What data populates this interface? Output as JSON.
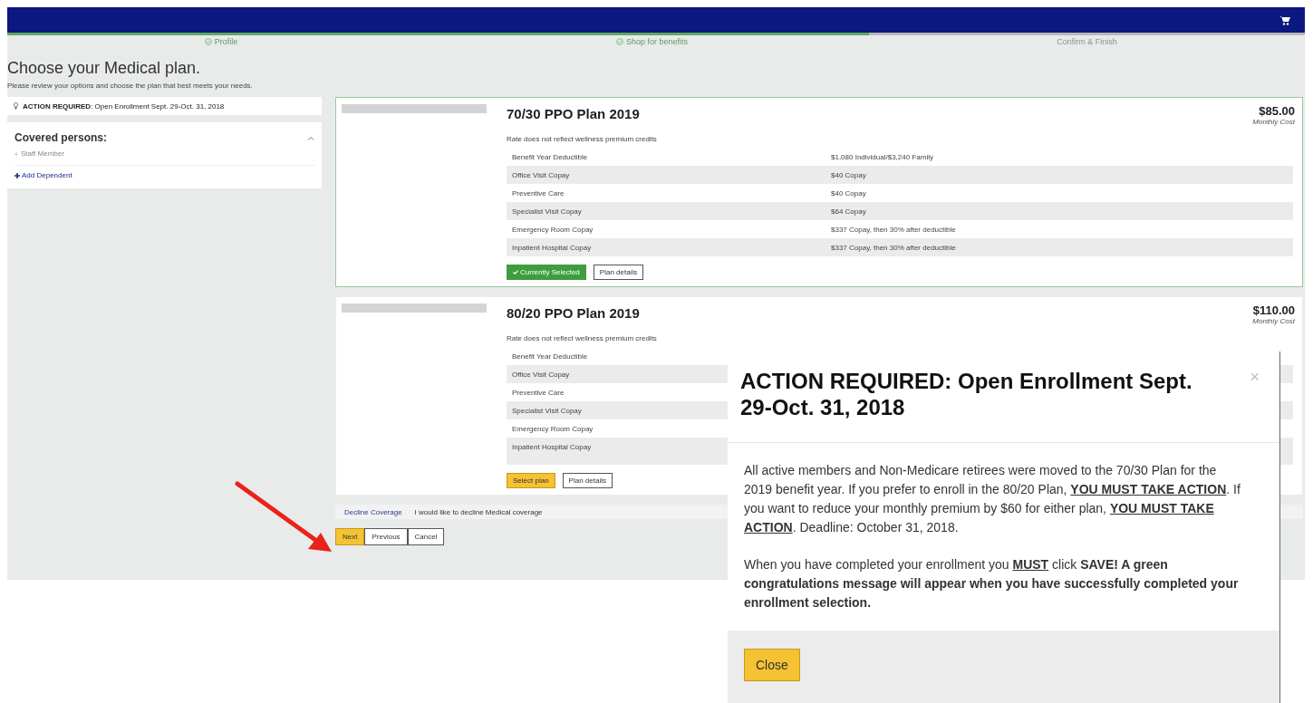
{
  "steps": [
    {
      "label": "Profile",
      "complete": true
    },
    {
      "label": "Shop for benefits",
      "complete": true
    },
    {
      "label": "Confirm & Finish",
      "complete": false
    }
  ],
  "heading": "Choose your Medical plan.",
  "subheading": "Please review your options and choose the plan that best meets your needs.",
  "sidebar": {
    "notice": "**ACTION REQUIRED**: Open Enrollment Sept. 29-Oct. 31, 2018",
    "covered_title": "Covered persons:",
    "expanded": true,
    "members": [
      "Staff Member"
    ],
    "add_link": "Add Dependent"
  },
  "plans": [
    {
      "name": "70/30 PPO Plan 2019",
      "price": "$85.00",
      "price_caption": "Monthly Cost",
      "note": "Rate does not reflect wellness premium credits",
      "selected": true,
      "action_label": "Currently Selected",
      "details_label": "Plan details",
      "rows": [
        {
          "label": "Benefit Year Deductible",
          "value": "$1,080 Individual/$3,240 Family"
        },
        {
          "label": "Office Visit Copay",
          "value": "$40 Copay"
        },
        {
          "label": "Preventive Care",
          "value": "$40 Copay"
        },
        {
          "label": "Specialist Visit Copay",
          "value": "$64 Copay"
        },
        {
          "label": "Emergency Room Copay",
          "value": "$337 Copay, then 30% after deductible"
        },
        {
          "label": "Inpatient Hospital Copay",
          "value": "$337 Copay, then 30% after deductible"
        }
      ]
    },
    {
      "name": "80/20 PPO Plan 2019",
      "price": "$110.00",
      "price_caption": "Monthly Cost",
      "note": "Rate does not reflect wellness premium credits",
      "selected": false,
      "action_label": "Select plan",
      "details_label": "Plan details",
      "rows": [
        {
          "label": "Benefit Year Deductible"
        },
        {
          "label": "Office Visit Copay"
        },
        {
          "label": "Preventive Care"
        },
        {
          "label": "Specialist Visit Copay"
        },
        {
          "label": "Emergency Room Copay"
        },
        {
          "label": "Inpatient Hospital Copay"
        }
      ]
    }
  ],
  "decline": {
    "link": "Decline Coverage",
    "text": "I would like to decline Medical coverage"
  },
  "nav_buttons": [
    {
      "label": "Next",
      "primary": true
    },
    {
      "label": "Previous",
      "primary": false
    },
    {
      "label": "Cancel",
      "primary": false
    }
  ],
  "modal": {
    "title": "ACTION REQUIRED: Open Enrollment Sept. 29-Oct. 31, 2018",
    "close_glyph": "×",
    "paragraphs": [
      [
        {
          "text": "All active members and Non-Medicare retirees were moved to the 70/30 Plan for the 2019 benefit year. If you prefer to enroll in the 80/20 Plan, "
        },
        {
          "text": "YOU MUST TAKE ACTION",
          "bold": true,
          "underline": true
        },
        {
          "text": ". If you want to reduce your monthly premium by $60 for either plan, "
        },
        {
          "text": "YOU MUST TAKE ACTION",
          "bold": true,
          "underline": true
        },
        {
          "text": ". Deadline: October 31, 2018."
        }
      ],
      [
        {
          "text": "When you have completed your enrollment you "
        },
        {
          "text": "MUST",
          "bold": true,
          "underline": true
        },
        {
          "text": " click "
        },
        {
          "text": "SAVE! A green congratulations message will appear when you have successfully completed your enrollment selection.",
          "bold": true
        }
      ]
    ],
    "button": "Close"
  }
}
